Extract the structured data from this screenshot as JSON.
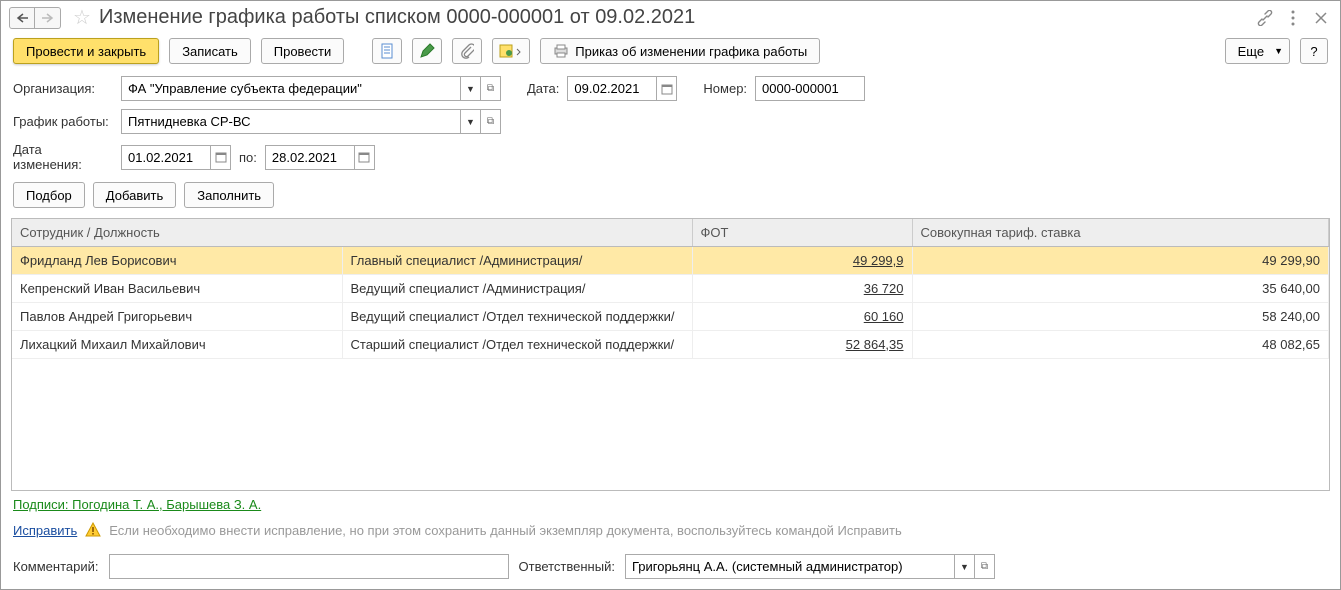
{
  "title": "Изменение графика работы списком 0000-000001 от 09.02.2021",
  "toolbar": {
    "post_and_close": "Провести и закрыть",
    "save": "Записать",
    "post": "Провести",
    "print_order": "Приказ об изменении графика работы",
    "more": "Еще",
    "help": "?"
  },
  "header": {
    "org_label": "Организация:",
    "org_value": "ФА \"Управление субъекта федерации\"",
    "date_label": "Дата:",
    "date_value": "09.02.2021",
    "number_label": "Номер:",
    "number_value": "0000-000001",
    "schedule_label": "График работы:",
    "schedule_value": "Пятнидневка СР-ВС",
    "change_date_label": "Дата изменения:",
    "change_date_from": "01.02.2021",
    "change_date_to_label": "по:",
    "change_date_to": "28.02.2021"
  },
  "row_buttons": {
    "pick": "Подбор",
    "add": "Добавить",
    "fill": "Заполнить"
  },
  "table": {
    "col_employee": "Сотрудник / Должность",
    "col_fot": "ФОТ",
    "col_rate": "Совокупная тариф. ставка",
    "rows": [
      {
        "name": "Фридланд Лев Борисович",
        "position": "Главный специалист /Администрация/",
        "fot": "49 299,9",
        "rate": "49 299,90",
        "selected": true
      },
      {
        "name": "Кепренский Иван Васильевич",
        "position": "Ведущий специалист /Администрация/",
        "fot": "36 720",
        "rate": "35 640,00"
      },
      {
        "name": "Павлов Андрей Григорьевич",
        "position": "Ведущий специалист /Отдел технической поддержки/",
        "fot": "60 160",
        "rate": "58 240,00"
      },
      {
        "name": "Лихацкий Михаил Михайлович",
        "position": "Старший специалист /Отдел технической поддержки/",
        "fot": "52 864,35",
        "rate": "48 082,65"
      }
    ]
  },
  "footer": {
    "signatures": "Подписи: Погодина Т. А., Барышева З. А.",
    "fix": "Исправить",
    "fix_hint": "Если необходимо внести исправление, но при этом сохранить данный экземпляр документа, воспользуйтесь командой Исправить",
    "comment_label": "Комментарий:",
    "comment_value": "",
    "responsible_label": "Ответственный:",
    "responsible_value": "Григорьянц А.А. (системный администратор)"
  }
}
